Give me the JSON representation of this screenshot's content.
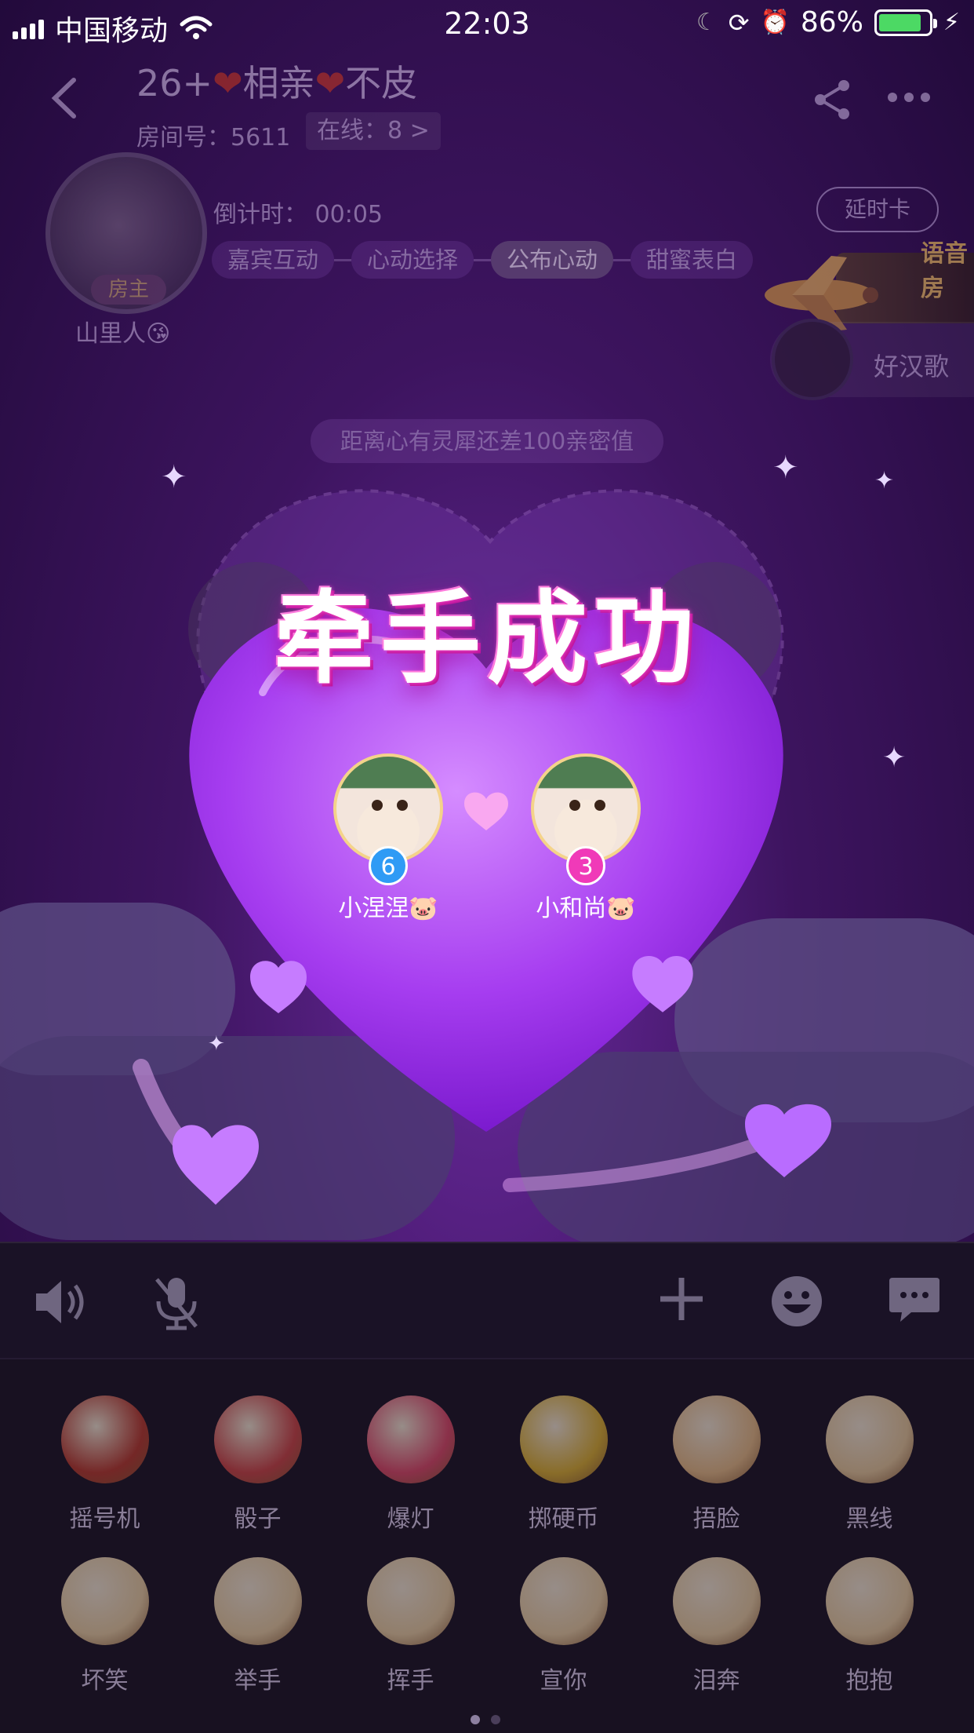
{
  "status_bar": {
    "carrier": "中国移动",
    "time": "22:03",
    "battery_percent": "86%",
    "battery_level": 0.86
  },
  "room": {
    "title_prefix": "26+",
    "title_middle": "相亲",
    "title_suffix": "不皮",
    "room_id": "房间号：5611",
    "online": "在线：8 >",
    "host_badge": "房主",
    "host_name": "山里人😘",
    "countdown": "倒计时：  00:05",
    "delay_card": "延时卡",
    "stages": [
      "嘉宾互动",
      "心动选择",
      "公布心动",
      "甜蜜表白"
    ],
    "active_stage": "公布心动",
    "voice_banner": "语音房",
    "guest_name": "好汉歌",
    "tip": "距离心有灵犀还差100亲密值"
  },
  "match_modal": {
    "title": "牵手成功",
    "left": {
      "name": "小涅涅🐷",
      "number": "6",
      "badge_color": "#2f9bf5"
    },
    "right": {
      "name": "小和尚🐷",
      "number": "3",
      "badge_color": "#f03ab8"
    }
  },
  "toolbar": {
    "icons": [
      "speaker-icon",
      "mic-muted-icon",
      "plus-icon",
      "emoji-icon",
      "chat-icon"
    ]
  },
  "emoji_panel": {
    "items": [
      {
        "label": "摇号机",
        "color": "#c0392b"
      },
      {
        "label": "骰子",
        "color": "#d64545"
      },
      {
        "label": "爆灯",
        "color": "#e84a6a"
      },
      {
        "label": "掷硬币",
        "color": "#e6b830"
      },
      {
        "label": "捂脸",
        "color": "#f2c48a"
      },
      {
        "label": "黑线",
        "color": "#f2d2a0"
      },
      {
        "label": "坏笑",
        "color": "#f5d8a8"
      },
      {
        "label": "举手",
        "color": "#f5d8a8"
      },
      {
        "label": "挥手",
        "color": "#f5d8a8"
      },
      {
        "label": "宣你",
        "color": "#f5d8a8"
      },
      {
        "label": "泪奔",
        "color": "#f5d8a8"
      },
      {
        "label": "抱抱",
        "color": "#f5d8a8"
      }
    ],
    "page_count": 2,
    "current_page": 1
  }
}
